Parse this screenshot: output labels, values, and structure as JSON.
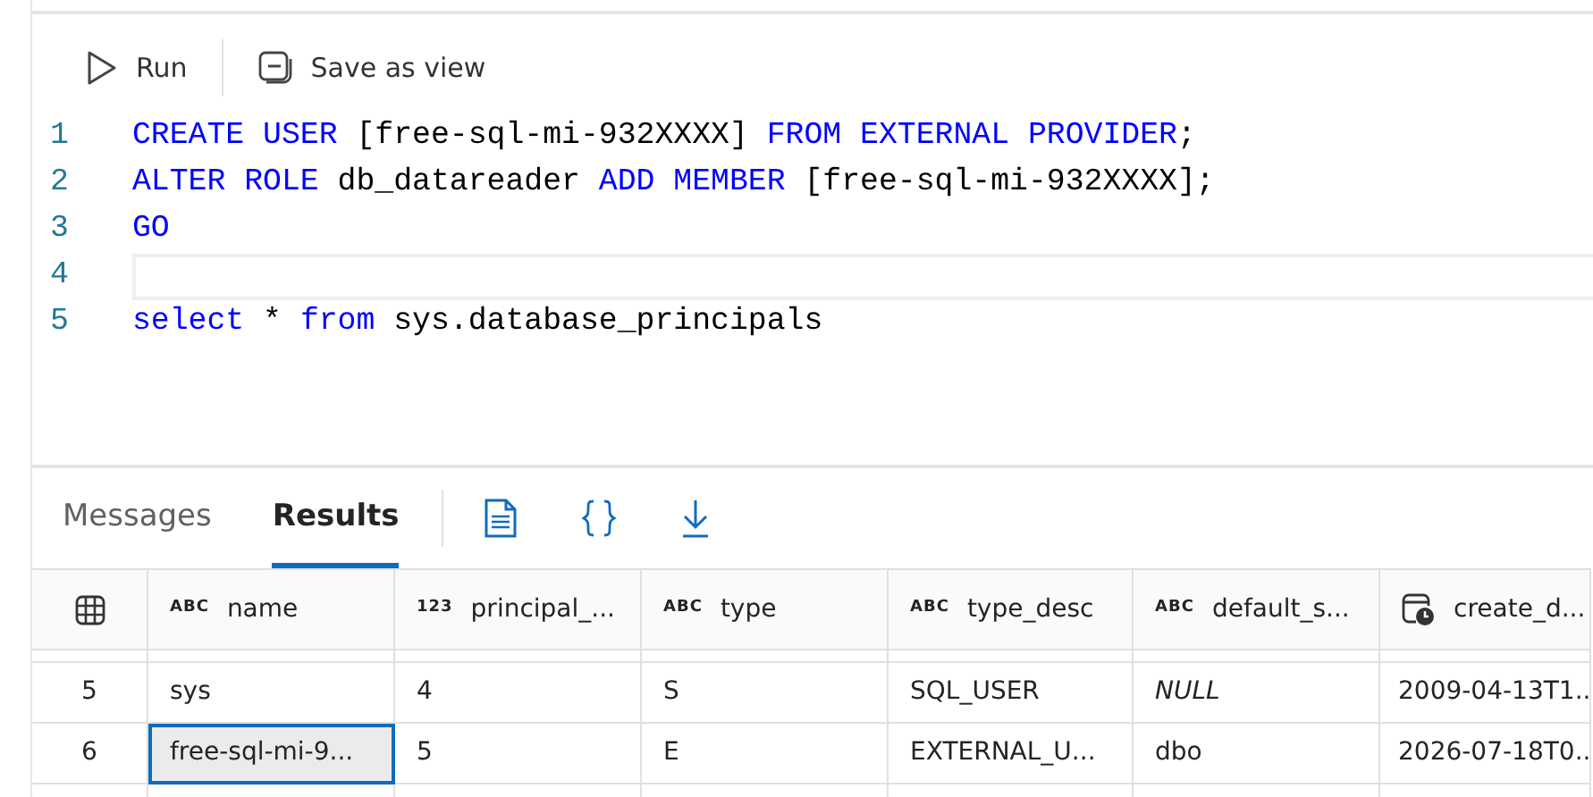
{
  "toolbar": {
    "run": "Run",
    "save_as_view": "Save as view"
  },
  "editor": {
    "lines": [
      {
        "number": "1",
        "current": false,
        "tokens": [
          {
            "text": "CREATE USER",
            "kind": "keyword"
          },
          {
            "text": " [free-sql-mi-932XXXX] ",
            "kind": "plain"
          },
          {
            "text": "FROM EXTERNAL PROVIDER",
            "kind": "keyword"
          },
          {
            "text": ";",
            "kind": "plain"
          }
        ]
      },
      {
        "number": "2",
        "current": false,
        "tokens": [
          {
            "text": "ALTER ROLE",
            "kind": "keyword"
          },
          {
            "text": " db_datareader ",
            "kind": "plain"
          },
          {
            "text": "ADD MEMBER",
            "kind": "keyword"
          },
          {
            "text": " [free-sql-mi-932XXXX];",
            "kind": "plain"
          }
        ]
      },
      {
        "number": "3",
        "current": false,
        "tokens": [
          {
            "text": "GO",
            "kind": "keyword"
          }
        ]
      },
      {
        "number": "4",
        "current": true
      },
      {
        "number": "5",
        "current": false,
        "tokens": [
          {
            "text": "select",
            "kind": "keyword"
          },
          {
            "text": " * ",
            "kind": "plain"
          },
          {
            "text": "from",
            "kind": "keyword"
          },
          {
            "text": " sys.database_principals",
            "kind": "plain"
          }
        ]
      }
    ]
  },
  "result_tabs": [
    {
      "label": "Messages",
      "selected": false
    },
    {
      "label": "Results",
      "selected": true
    }
  ],
  "table": {
    "columns": [
      {
        "label": "name",
        "type_label": "ABC",
        "kind": "text"
      },
      {
        "label": "principal_...",
        "type_label": "123",
        "kind": "number"
      },
      {
        "label": "type",
        "type_label": "ABC",
        "kind": "text"
      },
      {
        "label": "type_desc",
        "type_label": "ABC",
        "kind": "text"
      },
      {
        "label": "default_s...",
        "type_label": "ABC",
        "kind": "text"
      },
      {
        "label": "create_d...",
        "kind": "datetime"
      }
    ],
    "rows": [
      {
        "row_number": "5",
        "cells": [
          {
            "text": "sys",
            "kind": "value",
            "selected": false
          },
          {
            "text": "4",
            "kind": "value",
            "selected": false
          },
          {
            "text": "S",
            "kind": "value",
            "selected": false
          },
          {
            "text": "SQL_USER",
            "kind": "value",
            "selected": false
          },
          {
            "text": "NULL",
            "kind": "null",
            "selected": false
          },
          {
            "text": "2009-04-13T1..",
            "kind": "value",
            "selected": false
          }
        ]
      },
      {
        "row_number": "6",
        "cells": [
          {
            "text": "free-sql-mi-9...",
            "kind": "value",
            "selected": true
          },
          {
            "text": "5",
            "kind": "value",
            "selected": false
          },
          {
            "text": "E",
            "kind": "value",
            "selected": false
          },
          {
            "text": "EXTERNAL_U...",
            "kind": "value",
            "selected": false
          },
          {
            "text": "dbo",
            "kind": "value",
            "selected": false
          },
          {
            "text": "2026-07-18T0..",
            "kind": "value",
            "selected": false
          }
        ]
      }
    ]
  }
}
